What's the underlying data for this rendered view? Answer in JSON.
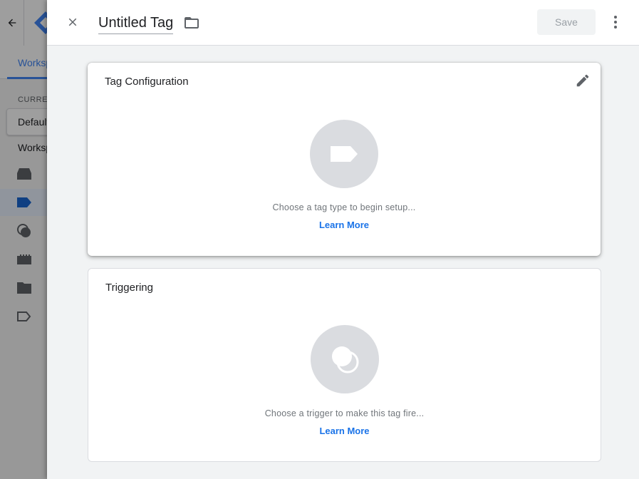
{
  "background": {
    "workspace_tab": "Workspace",
    "current_label": "CURRENT WORKSPACE",
    "default_workspace": "Default Workspace"
  },
  "panel": {
    "title": "Untitled Tag",
    "save_label": "Save",
    "tag_configuration": {
      "title": "Tag Configuration",
      "hint": "Choose a tag type to begin setup...",
      "learn_more": "Learn More"
    },
    "triggering": {
      "title": "Triggering",
      "hint": "Choose a trigger to make this tag fire...",
      "learn_more": "Learn More"
    }
  },
  "colors": {
    "accent": "#1a73e8",
    "placeholder_circle": "#dadce0",
    "panel_bg": "#f1f3f4"
  }
}
